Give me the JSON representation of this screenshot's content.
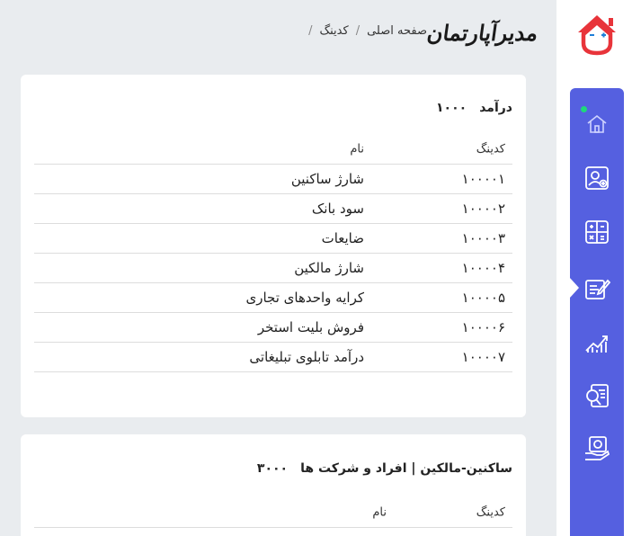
{
  "header": {
    "brand": "مدیرآپارتمان",
    "breadcrumb": [
      "صفحه اصلی",
      "کدینگ"
    ],
    "separator": "/"
  },
  "colors": {
    "sidebar": "#5560e0",
    "accent_red": "#e8343a",
    "status_dot": "#1ed97a"
  },
  "sidebar": {
    "items": [
      {
        "icon": "home-icon"
      },
      {
        "icon": "user-add-icon"
      },
      {
        "icon": "calculator-icon"
      },
      {
        "icon": "edit-document-icon"
      },
      {
        "icon": "growth-chart-icon"
      },
      {
        "icon": "document-search-icon"
      },
      {
        "icon": "money-hand-icon"
      }
    ]
  },
  "income_card": {
    "title": "درآمد",
    "code": "۱۰۰۰",
    "headers": {
      "code": "کدینگ",
      "name": "نام"
    },
    "rows": [
      {
        "code": "۱۰۰۰۰۱",
        "name": "شارژ ساکنین"
      },
      {
        "code": "۱۰۰۰۰۲",
        "name": "سود بانک"
      },
      {
        "code": "۱۰۰۰۰۳",
        "name": "ضایعات"
      },
      {
        "code": "۱۰۰۰۰۴",
        "name": "شارژ مالکین"
      },
      {
        "code": "۱۰۰۰۰۵",
        "name": "کرایه واحدهای تجاری"
      },
      {
        "code": "۱۰۰۰۰۶",
        "name": "فروش بلیت استخر"
      },
      {
        "code": "۱۰۰۰۰۷",
        "name": "درآمد تابلوی تبلیغاتی"
      }
    ]
  },
  "residents_card": {
    "title": "ساکنین-مالکین | افراد و شرکت ها",
    "code": "۳۰۰۰",
    "headers": {
      "code": "کدینگ",
      "name": "نام"
    }
  }
}
